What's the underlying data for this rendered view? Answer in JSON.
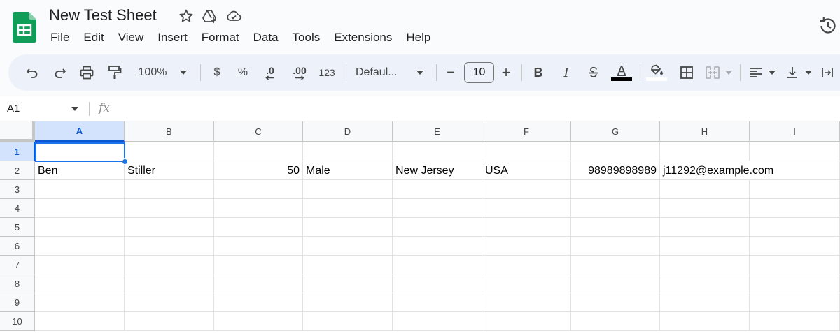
{
  "app": {
    "doc_title": "New Test Sheet",
    "menu": [
      "File",
      "Edit",
      "View",
      "Insert",
      "Format",
      "Data",
      "Tools",
      "Extensions",
      "Help"
    ]
  },
  "toolbar": {
    "zoom": "100%",
    "currency": "$",
    "percent": "%",
    "decrease_decimal": ".0",
    "increase_decimal": ".00",
    "number_format": "123",
    "font": "Defaul...",
    "font_size": "10",
    "minus": "−",
    "plus": "+",
    "bold": "B",
    "italic": "I",
    "text_color_letter": "A"
  },
  "formula_bar": {
    "cell_ref": "A1",
    "fx": "fx",
    "content": ""
  },
  "grid": {
    "columns": [
      "A",
      "B",
      "C",
      "D",
      "E",
      "F",
      "G",
      "H",
      "I"
    ],
    "rows": [
      "1",
      "2",
      "3",
      "4",
      "5",
      "6",
      "7",
      "8",
      "9",
      "10"
    ],
    "selected_cell": "A1",
    "cells": {
      "A2": "Ben",
      "B2": "Stiller",
      "C2": "50",
      "D2": "Male",
      "E2": "New Jersey",
      "F2": "USA",
      "G2": "98989898989",
      "H2": "j11292@example.com"
    }
  },
  "colors": {
    "accent": "#1a73e8",
    "logo_green": "#0f9d58",
    "header_bg": "#f9fbfd",
    "toolbar_bg": "#edf2fa"
  }
}
